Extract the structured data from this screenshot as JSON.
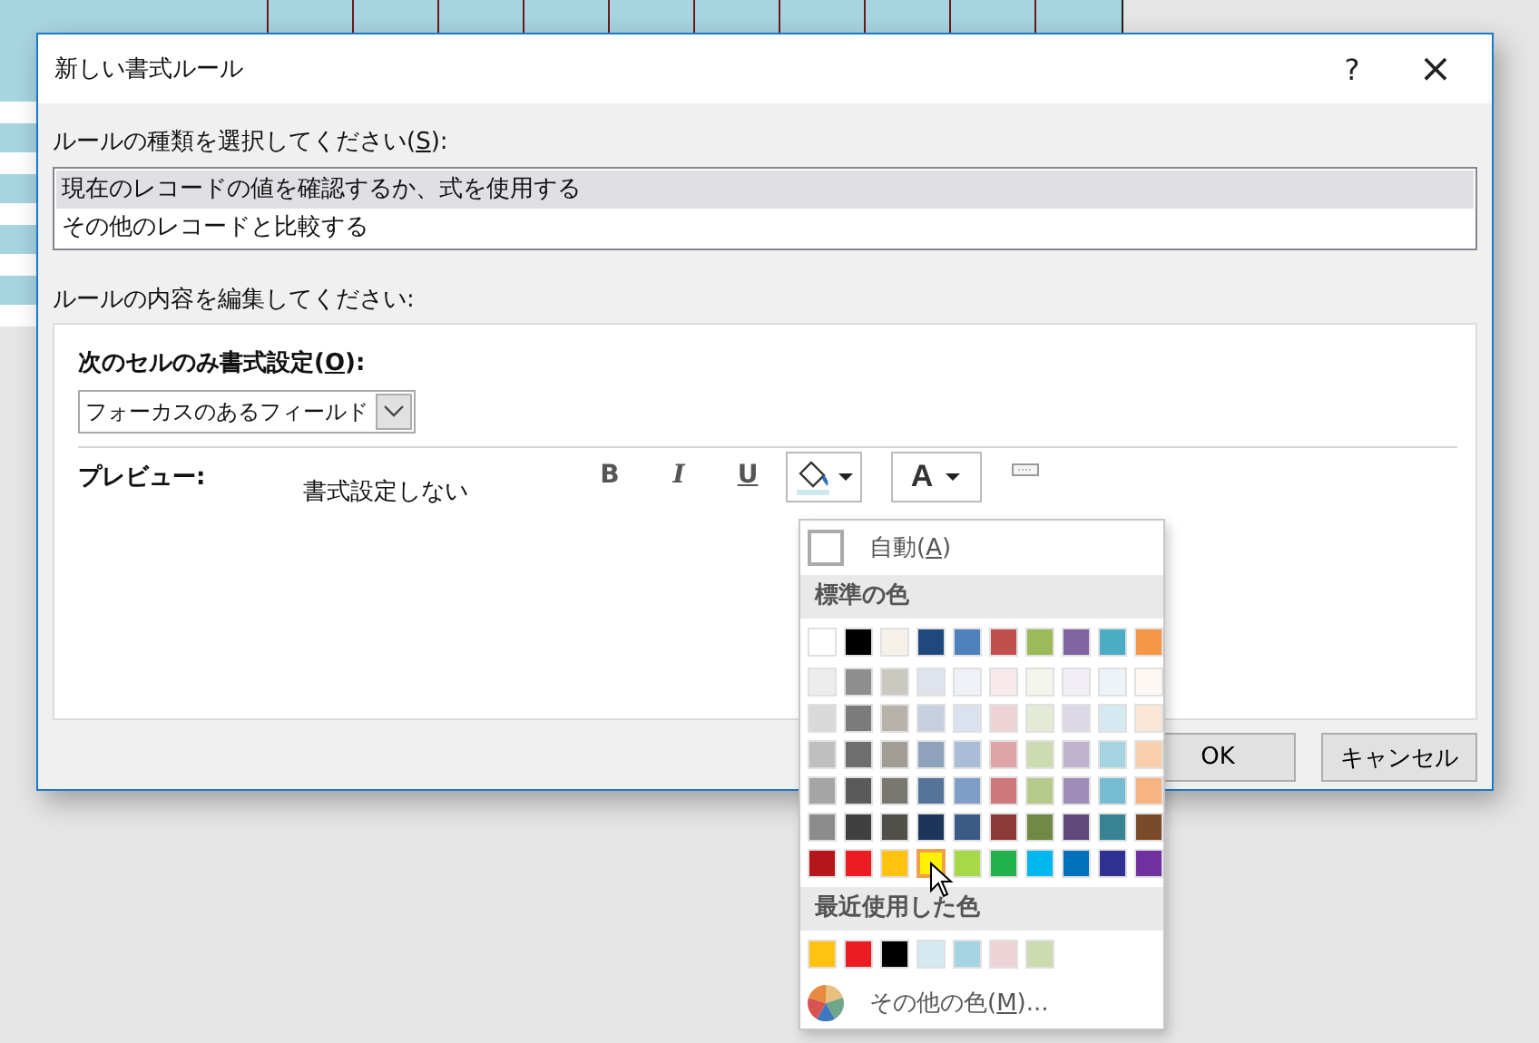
{
  "dialog": {
    "title": "新しい書式ルール",
    "help": "?",
    "close": "×",
    "rule_type_label": "ルールの種類を選択してください(S):",
    "rule_types": [
      {
        "label": "現在のレコードの値を確認するか、式を使用する",
        "selected": true
      },
      {
        "label": "その他のレコードと比較する",
        "selected": false
      }
    ],
    "edit_label": "ルールの内容を編集してください:",
    "condition_label": "次のセルのみ書式設定(O):",
    "condition_value": "フォーカスのあるフィールド",
    "preview_label": "プレビュー:",
    "preview_text": "書式設定しない",
    "toolbar": [
      {
        "kind": "bold",
        "label": "B"
      },
      {
        "kind": "italic",
        "label": "I"
      },
      {
        "kind": "underline",
        "label": "U"
      },
      {
        "kind": "fill"
      },
      {
        "kind": "fontcolor",
        "label": "A"
      },
      {
        "kind": "border"
      }
    ],
    "buttons": [
      "OK",
      "キャンセル"
    ]
  },
  "color_menu": {
    "auto_label": "自動(A)",
    "standard_heading": "標準の色",
    "rows": [
      [
        {
          "color": "#ffffff",
          "selected": false
        },
        {
          "color": "#000000",
          "selected": false
        },
        {
          "color": "#f6f1e8",
          "selected": false
        },
        {
          "color": "#1f497d",
          "selected": false
        },
        {
          "color": "#4f81bd",
          "selected": false
        },
        {
          "color": "#c0504d",
          "selected": false
        },
        {
          "color": "#9bbb59",
          "selected": false
        },
        {
          "color": "#8064a2",
          "selected": false
        },
        {
          "color": "#4bacc6",
          "selected": false
        },
        {
          "color": "#f79646",
          "selected": false
        }
      ],
      [
        {
          "color": "#ececec",
          "selected": false
        },
        {
          "color": "#8e8e8e",
          "selected": false
        },
        {
          "color": "#cbc8c0",
          "selected": false
        },
        {
          "color": "#dfe4ec",
          "selected": false
        },
        {
          "color": "#eef2f7",
          "selected": false
        },
        {
          "color": "#f8eaeb",
          "selected": false
        },
        {
          "color": "#f3f5ec",
          "selected": false
        },
        {
          "color": "#f1eff5",
          "selected": false
        },
        {
          "color": "#ecf4f7",
          "selected": false
        },
        {
          "color": "#fdf8f4",
          "selected": false
        }
      ],
      [
        {
          "color": "#d9d9d9",
          "selected": false
        },
        {
          "color": "#7b7b7b",
          "selected": false
        },
        {
          "color": "#b7b3aa",
          "selected": false
        },
        {
          "color": "#c5cfdd",
          "selected": false
        },
        {
          "color": "#dae2ef",
          "selected": false
        },
        {
          "color": "#eed2d6",
          "selected": false
        },
        {
          "color": "#e3ebd6",
          "selected": false
        },
        {
          "color": "#ddd8e6",
          "selected": false
        },
        {
          "color": "#d4e9f0",
          "selected": false
        },
        {
          "color": "#fce6d7",
          "selected": false
        }
      ],
      [
        {
          "color": "#bfbfbf",
          "selected": false
        },
        {
          "color": "#6e6e6e",
          "selected": false
        },
        {
          "color": "#a29d94",
          "selected": false
        },
        {
          "color": "#8fa2bc",
          "selected": false
        },
        {
          "color": "#aabcd8",
          "selected": false
        },
        {
          "color": "#dfa5a6",
          "selected": false
        },
        {
          "color": "#cddbb0",
          "selected": false
        },
        {
          "color": "#bfb2cf",
          "selected": false
        },
        {
          "color": "#a5d3e1",
          "selected": false
        },
        {
          "color": "#f9cfab",
          "selected": false
        }
      ],
      [
        {
          "color": "#a5a5a5",
          "selected": false
        },
        {
          "color": "#5a5a5a",
          "selected": false
        },
        {
          "color": "#7a7670",
          "selected": false
        },
        {
          "color": "#56739a",
          "selected": false
        },
        {
          "color": "#7f9ec7",
          "selected": false
        },
        {
          "color": "#cf7879",
          "selected": false
        },
        {
          "color": "#b6cb8a",
          "selected": false
        },
        {
          "color": "#a08cb8",
          "selected": false
        },
        {
          "color": "#76bdd3",
          "selected": false
        },
        {
          "color": "#f6b482",
          "selected": false
        }
      ],
      [
        {
          "color": "#8c8c8c",
          "selected": false
        },
        {
          "color": "#404040",
          "selected": false
        },
        {
          "color": "#514f4a",
          "selected": false
        },
        {
          "color": "#1d355a",
          "selected": false
        },
        {
          "color": "#3b5b86",
          "selected": false
        },
        {
          "color": "#8d3938",
          "selected": false
        },
        {
          "color": "#708944",
          "selected": false
        },
        {
          "color": "#5f4a7b",
          "selected": false
        },
        {
          "color": "#378391",
          "selected": false
        },
        {
          "color": "#794b2a",
          "selected": false
        }
      ],
      [
        {
          "color": "#b5161b",
          "selected": false
        },
        {
          "color": "#ed1c24",
          "selected": false
        },
        {
          "color": "#ffc20e",
          "selected": false
        },
        {
          "color": "#fff200",
          "selected": true
        },
        {
          "color": "#a6d84a",
          "selected": false
        },
        {
          "color": "#22b14c",
          "selected": false
        },
        {
          "color": "#00b7ef",
          "selected": false
        },
        {
          "color": "#0072bc",
          "selected": false
        },
        {
          "color": "#2e3192",
          "selected": false
        },
        {
          "color": "#7030a0",
          "selected": false
        }
      ]
    ],
    "recent_heading": "最近使用した色",
    "recent": [
      {
        "color": "#ffc20e"
      },
      {
        "color": "#ed1c24"
      },
      {
        "color": "#000000"
      },
      {
        "color": "#d4e9f0"
      },
      {
        "color": "#a5d3e1"
      },
      {
        "color": "#eed2d6"
      },
      {
        "color": "#cddbb0"
      }
    ],
    "more_label": "その他の色(M)..."
  }
}
